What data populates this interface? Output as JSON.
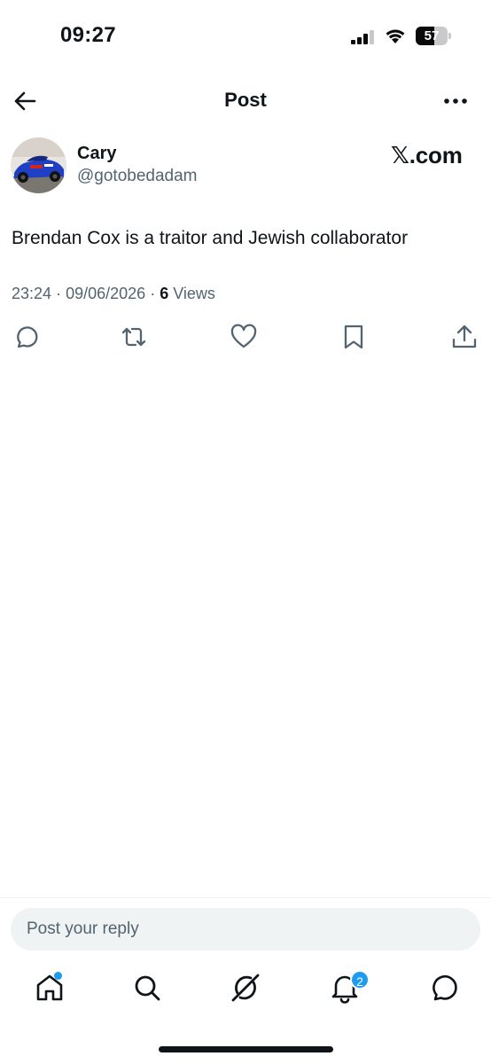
{
  "status_bar": {
    "time": "09:27",
    "battery_level": "57",
    "battery_fraction": 0.57
  },
  "header": {
    "title": "Post",
    "back_icon": "arrow-left-icon",
    "more_icon": "more-horizontal-icon"
  },
  "author": {
    "name": "Cary",
    "handle": "@gotobedadam",
    "avatar": "avatar-blue-race-car"
  },
  "source_label": "𝕏.com",
  "post": {
    "text": "Brendan Cox is a traitor and Jewish collaborator",
    "time": "23:24",
    "date": "09/06/2026",
    "separator": "·",
    "views_count": "6",
    "views_label": "Views"
  },
  "actions": [
    {
      "name": "reply",
      "icon": "reply-icon"
    },
    {
      "name": "repost",
      "icon": "repost-icon"
    },
    {
      "name": "like",
      "icon": "heart-icon"
    },
    {
      "name": "bookmark",
      "icon": "bookmark-icon"
    },
    {
      "name": "share",
      "icon": "share-icon"
    }
  ],
  "reply": {
    "placeholder": "Post your reply"
  },
  "tabs": [
    {
      "name": "home",
      "icon": "home-icon",
      "has_dot": true
    },
    {
      "name": "search",
      "icon": "search-icon"
    },
    {
      "name": "grok",
      "icon": "grok-icon"
    },
    {
      "name": "notifications",
      "icon": "bell-icon",
      "badge": "2"
    },
    {
      "name": "messages",
      "icon": "message-icon"
    }
  ],
  "colors": {
    "accent": "#1d9bf0",
    "text": "#0f1419",
    "secondary": "#536471",
    "reply_bg": "#eff3f4"
  }
}
